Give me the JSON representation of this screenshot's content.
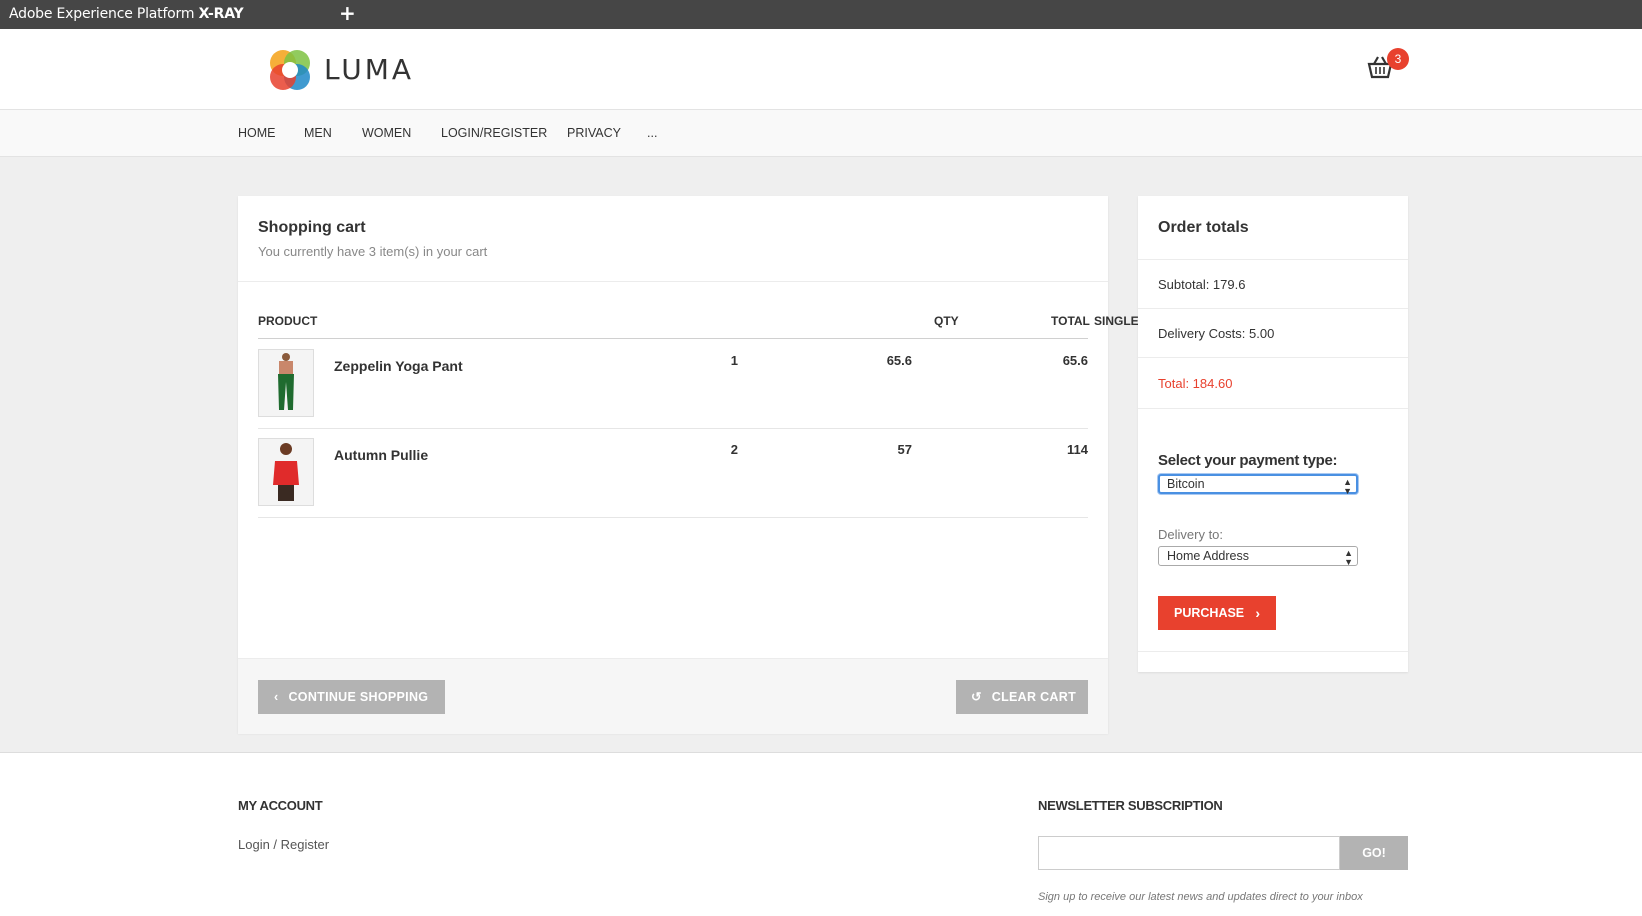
{
  "xray": {
    "title_prefix": "Adobe Experience Platform",
    "title_bold": "X-RAY",
    "add_label": "+"
  },
  "header": {
    "brand": "LUMA",
    "cart_count": "3"
  },
  "nav": {
    "items": [
      "HOME",
      "MEN",
      "WOMEN",
      "LOGIN/REGISTER",
      "PRIVACY",
      "..."
    ]
  },
  "cart": {
    "title": "Shopping cart",
    "subtitle": "You currently have 3 item(s) in your cart",
    "columns": {
      "product": "PRODUCT",
      "qty": "QTY",
      "single": "SINGLE",
      "total": "TOTAL"
    },
    "rows": [
      {
        "name": "Zeppelin Yoga Pant",
        "qty": "1",
        "single": "65.6",
        "total": "65.6"
      },
      {
        "name": "Autumn Pullie",
        "qty": "2",
        "single": "57",
        "total": "114"
      }
    ],
    "continue_label": "CONTINUE SHOPPING",
    "clear_label": "CLEAR CART"
  },
  "totals": {
    "title": "Order totals",
    "subtotal": "Subtotal: 179.6",
    "delivery": "Delivery Costs: 5.00",
    "total": "Total: 184.60",
    "payment_label": "Select your payment type:",
    "payment_value": "Bitcoin",
    "delivery_label": "Delivery to:",
    "delivery_value": "Home Address",
    "purchase_label": "PURCHASE",
    "total_color": "#e8412e"
  },
  "footer": {
    "account_heading": "MY ACCOUNT",
    "account_link": "Login / Register",
    "newsletter_heading": "NEWSLETTER SUBSCRIPTION",
    "newsletter_button": "GO!",
    "newsletter_note": "Sign up to receive our latest news and updates direct to your inbox"
  }
}
